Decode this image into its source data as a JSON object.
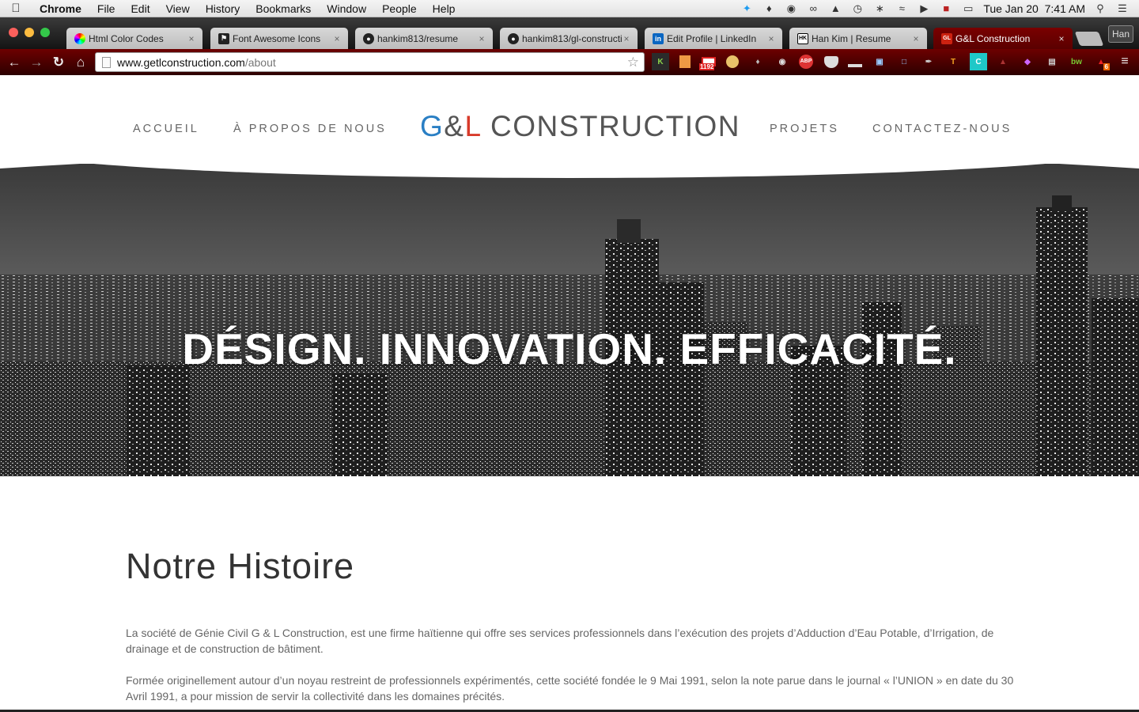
{
  "menubar": {
    "apple": "",
    "app": "Chrome",
    "items": [
      "File",
      "Edit",
      "View",
      "History",
      "Bookmarks",
      "Window",
      "People",
      "Help"
    ],
    "clock": "Tue Jan 20  7:41 AM"
  },
  "tabs": [
    {
      "title": "Html Color Codes",
      "favicon": "color-wheel"
    },
    {
      "title": "Font Awesome Icons",
      "favicon": "flag"
    },
    {
      "title": "hankim813/resume",
      "favicon": "github"
    },
    {
      "title": "hankim813/gl-constructi",
      "favicon": "github"
    },
    {
      "title": "Edit Profile | LinkedIn",
      "favicon": "linkedin"
    },
    {
      "title": "Han Kim | Resume",
      "favicon": "hk"
    },
    {
      "title": "G&L Construction",
      "favicon": "gl",
      "active": true
    }
  ],
  "user_button": "Han",
  "address": {
    "domain": "www.getlconstruction.com",
    "path": "/about"
  },
  "extensions": {
    "gmail_count": "1192",
    "badge_count": "6"
  },
  "site": {
    "nav_left": [
      "ACCUEIL",
      "À PROPOS DE NOUS"
    ],
    "logo": {
      "g": "G",
      "amp": "&",
      "l": "L",
      "rest": " CONSTRUCTION"
    },
    "nav_right": [
      "PROJETS",
      "CONTACTEZ-NOUS"
    ],
    "hero_title": "DÉSIGN. INNOVATION. EFFICACITÉ.",
    "section_title": "Notre Histoire",
    "paragraphs": [
      "La société de Génie Civil G & L Construction, est une firme haïtienne qui offre ses services professionnels dans l’exécution des projets d’Adduction d’Eau Potable, d’Irrigation, de drainage et de construction de bâtiment.",
      "Formée originellement autour d’un noyau restreint de professionnels expérimentés, cette société fondée le 9 Mai 1991, selon la note parue dans le journal « l’UNION » en date du 30 Avril 1991, a pour mission de servir la collectivité dans les domaines précités."
    ]
  },
  "colors": {
    "accent_blue": "#2a7fc4",
    "accent_red": "#d83a2a",
    "toolbar": "#5a0000"
  }
}
